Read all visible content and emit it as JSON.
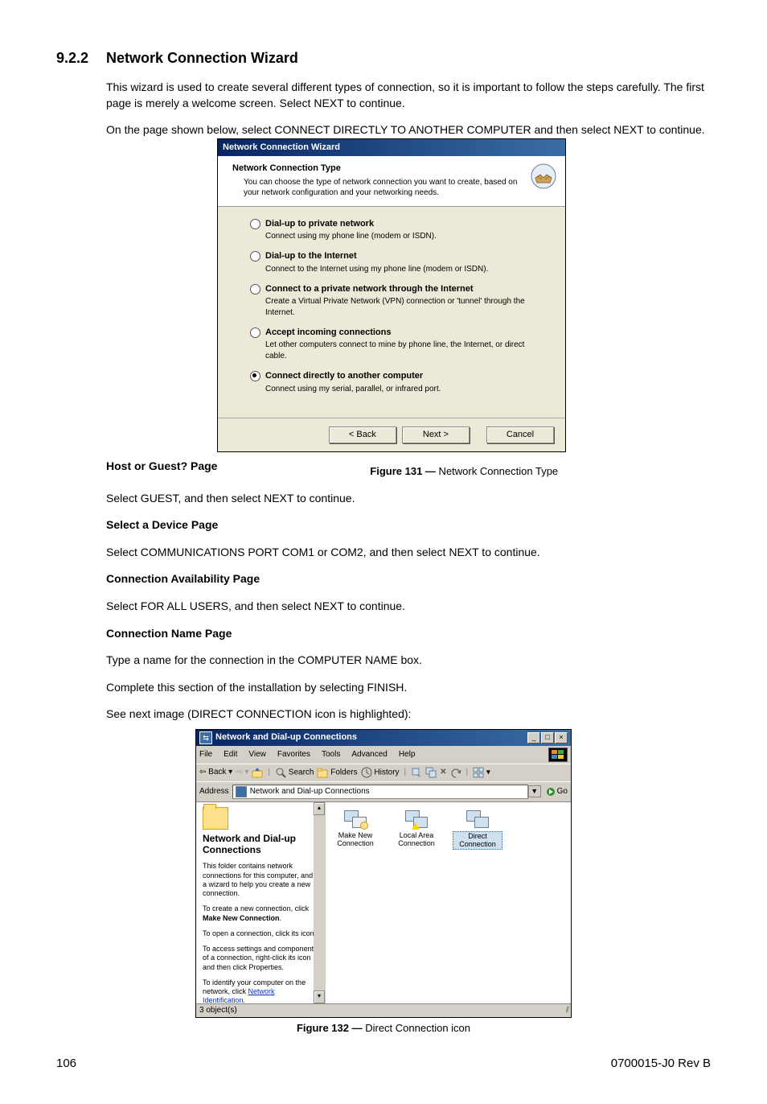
{
  "section": {
    "number": "9.2.2",
    "title": "Network Connection Wizard",
    "intro1": "This wizard is used to create several different types of connection, so it is important to follow the steps carefully. The first page is merely a welcome screen. Select NEXT to continue.",
    "intro2": "On the page shown below, select CONNECT DIRECTLY TO ANOTHER COMPUTER and then select NEXT to continue."
  },
  "wizard": {
    "title": "Network Connection Wizard",
    "header_title": "Network Connection Type",
    "header_desc": "You can choose the type of network connection you want to create, based on your network configuration and your networking needs.",
    "options": [
      {
        "label": "Dial-up to private network",
        "desc": "Connect using my phone line (modem or ISDN).",
        "selected": false
      },
      {
        "label": "Dial-up to the Internet",
        "desc": "Connect to the Internet using my phone line (modem or ISDN).",
        "selected": false
      },
      {
        "label": "Connect to a private network through the Internet",
        "desc": "Create a Virtual Private Network (VPN) connection or 'tunnel' through the Internet.",
        "selected": false
      },
      {
        "label": "Accept incoming connections",
        "desc": "Let other computers connect to mine by phone line, the Internet, or direct cable.",
        "selected": false
      },
      {
        "label": "Connect directly to another computer",
        "desc": "Connect using my serial, parallel, or infrared port.",
        "selected": true
      }
    ],
    "buttons": {
      "back": "< Back",
      "next": "Next >",
      "cancel": "Cancel"
    }
  },
  "figure131": {
    "label": "Figure 131  —",
    "caption": "  Network Connection Type"
  },
  "sub": {
    "host_title": "Host or Guest? Page",
    "host_text": "Select GUEST, and then select NEXT to continue.",
    "device_title": "Select a Device Page",
    "device_text": "Select COMMUNICATIONS PORT COM1 or COM2, and then select NEXT to continue.",
    "avail_title": "Connection Availability Page",
    "avail_text": "Select FOR ALL USERS, and then select NEXT to continue.",
    "name_title": "Connection Name Page",
    "name_text1": "Type a name for the connection in the COMPUTER NAME box.",
    "name_text2": "Complete this section of the installation by selecting FINISH.",
    "name_text3": "See next image (DIRECT CONNECTION icon is highlighted):"
  },
  "explorer": {
    "title": "Network and Dial-up Connections",
    "menus": [
      "File",
      "Edit",
      "View",
      "Favorites",
      "Tools",
      "Advanced",
      "Help"
    ],
    "toolbar": {
      "back": "Back",
      "search": "Search",
      "folders": "Folders",
      "history": "History"
    },
    "address_label": "Address",
    "address_value": "Network and Dial-up Connections",
    "go_label": "Go",
    "side": {
      "title": "Network and Dial-up Connections",
      "p1": "This folder contains network connections for this computer, and a wizard to help you create a new connection.",
      "p2a": "To create a new connection, click ",
      "p2b": "Make New Connection",
      "p2c": ".",
      "p3": "To open a connection, click its icon.",
      "p4": "To access settings and components of a connection, right-click its icon and then click Properties.",
      "p5a": "To identify your computer on the network, click ",
      "p5b": "Network Identification",
      "p5c": "."
    },
    "items": [
      {
        "label": "Make New Connection",
        "type": "wizard"
      },
      {
        "label": "Local Area Connection",
        "type": "lan"
      },
      {
        "label": "Direct Connection",
        "type": "direct",
        "selected": true
      }
    ],
    "status": "3 object(s)"
  },
  "figure132": {
    "label": "Figure 132  —",
    "caption": "  Direct Connection icon"
  },
  "footer": {
    "page": "106",
    "doc": "0700015-J0    Rev B"
  }
}
